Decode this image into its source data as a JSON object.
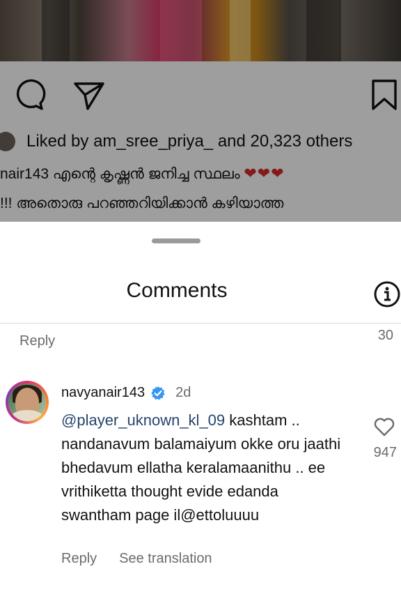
{
  "post": {
    "liked_by_prefix": "Liked by",
    "liked_by_user": "am_sree_priya_",
    "liked_by_mid": "and",
    "liked_by_count": "20,323 others",
    "caption_line1": "nair143 എന്റെ കൃഷ്ണൻ ജനിച്ച സ്ഥലം",
    "caption_hearts": "❤❤❤",
    "caption_line2": "!!! അതൊരു പറഞ്ഞറിയിക്കാൻ കഴിയാത്ത"
  },
  "sheet": {
    "title": "Comments",
    "prev_reply_label": "Reply",
    "prev_like_count": "30"
  },
  "comment": {
    "username": "navyanair143",
    "time": "2d",
    "mention": "@player_uknown_kl_09",
    "text": " kashtam .. nandanavum balamaiyum okke oru jaathi bhedavum ellatha keralamaanithu .. ee vrithiketta thought evide edanda swantham page il@ettoluuuu",
    "reply_label": "Reply",
    "translate_label": "See translation",
    "like_count": "947"
  },
  "colors": {
    "mention": "#26446e",
    "verified": "#3897f0",
    "heart": "#d62b2b",
    "secondary_text": "#6b6b6b"
  },
  "icons": [
    "comment-icon",
    "share-icon",
    "bookmark-icon",
    "info-icon",
    "verified-icon",
    "heart-icon"
  ]
}
